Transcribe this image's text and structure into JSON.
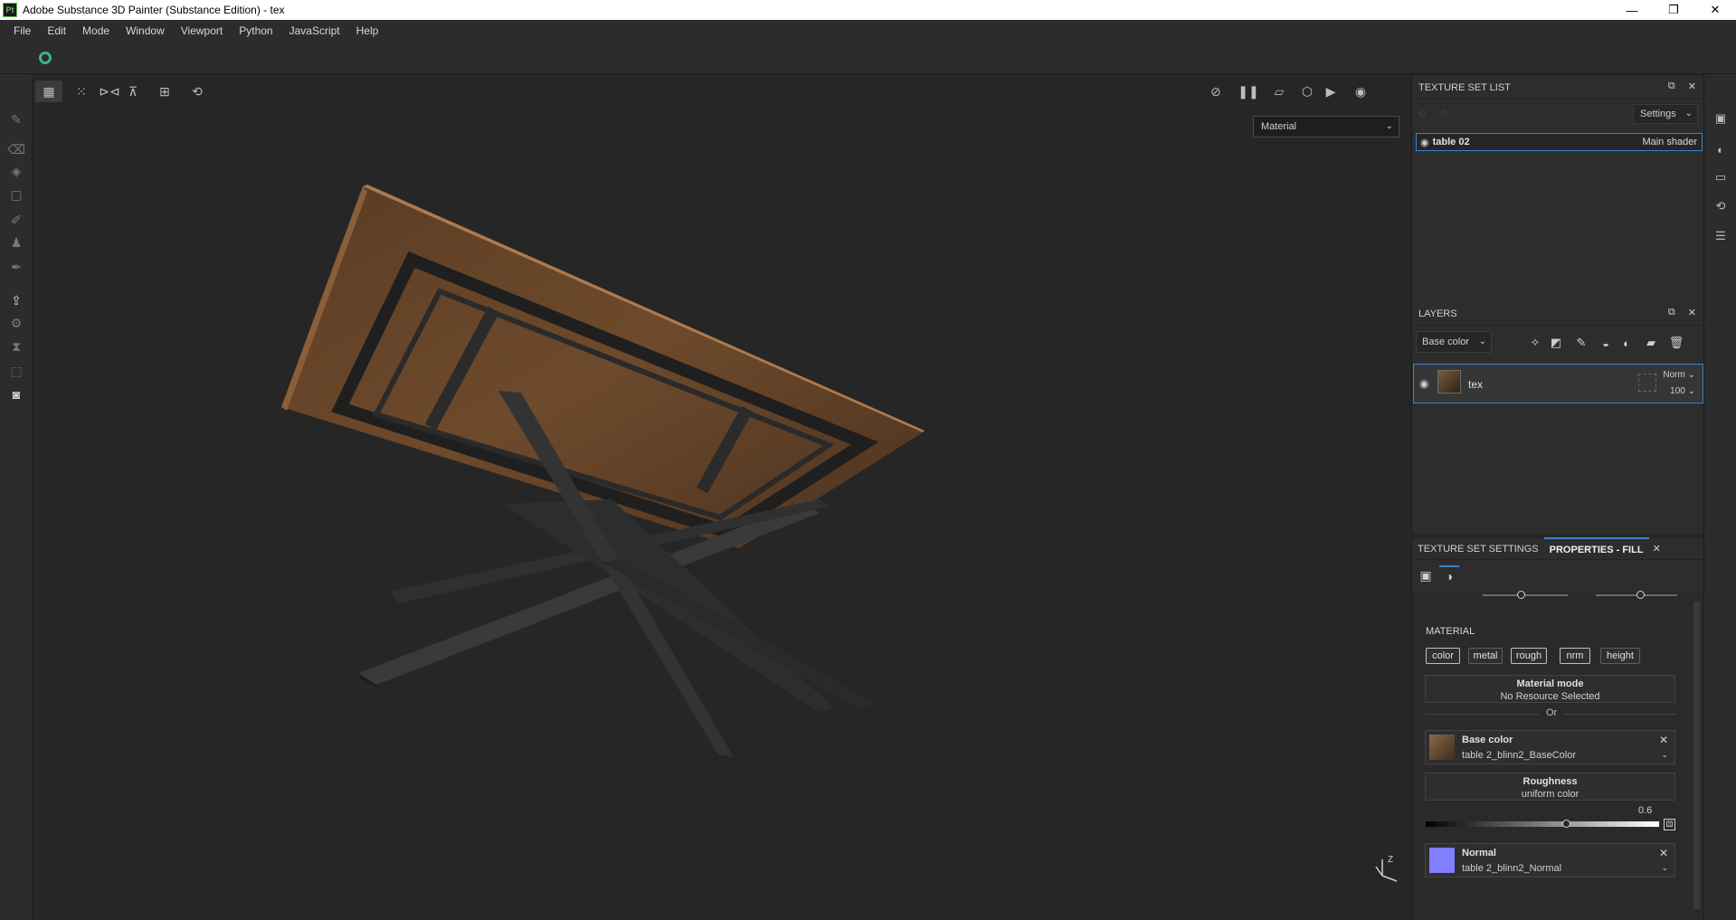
{
  "titlebar": {
    "icon_text": "Pt",
    "title": "Adobe Substance 3D Painter (Substance Edition) - tex",
    "minimize": "—",
    "maximize": "❐",
    "close": "✕"
  },
  "menu": [
    "File",
    "Edit",
    "Mode",
    "Window",
    "Viewport",
    "Python",
    "JavaScript",
    "Help"
  ],
  "viewport": {
    "mode_dropdown": "Material"
  },
  "texture_set_list": {
    "title": "TEXTURE SET LIST",
    "settings_label": "Settings",
    "row": {
      "name": "table 02",
      "shader": "Main shader"
    }
  },
  "layers": {
    "title": "LAYERS",
    "channel_dropdown": "Base color",
    "layer": {
      "name": "tex",
      "blend": "Norm",
      "opacity": "100"
    }
  },
  "properties": {
    "tab_texture_set_settings": "TEXTURE SET SETTINGS",
    "tab_properties_fill": "PROPERTIES - FILL",
    "material_title": "MATERIAL",
    "channels": [
      "color",
      "metal",
      "rough",
      "nrm",
      "height"
    ],
    "material_mode_title": "Material mode",
    "material_mode_value": "No Resource Selected",
    "or_text": "Or",
    "base_color": {
      "title": "Base color",
      "value": "table 2_blinn2_BaseColor"
    },
    "roughness": {
      "title": "Roughness",
      "value": "uniform color",
      "number": "0.6",
      "level": 0.6
    },
    "normal": {
      "title": "Normal",
      "value": "table 2_blinn2_Normal",
      "color": "#7f7fff"
    }
  },
  "colors": {
    "accent": "#3b82c9",
    "wood": "#7a5234",
    "metal": "#2e2e2e"
  }
}
